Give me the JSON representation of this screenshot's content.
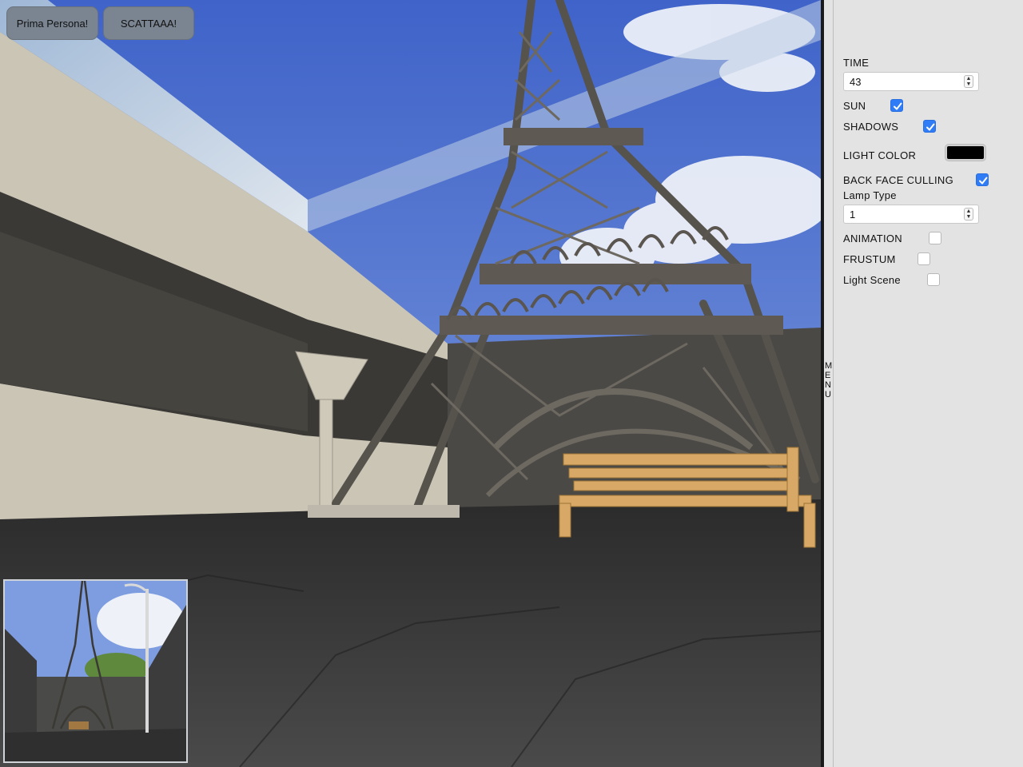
{
  "toolbar": {
    "first_person_label": "Prima Persona!",
    "shoot_label": "SCATTAAA!"
  },
  "menu_strip": {
    "label": "MENU"
  },
  "controls": {
    "time": {
      "label": "TIME",
      "value": "43"
    },
    "sun": {
      "label": "SUN",
      "checked": true
    },
    "shadows": {
      "label": "SHADOWS",
      "checked": true
    },
    "light_color": {
      "label": "LIGHT COLOR",
      "value": "#000000"
    },
    "back_face_culling": {
      "label": "BACK FACE CULLING",
      "checked": true
    },
    "lamp_type": {
      "label": "Lamp Type",
      "value": "1"
    },
    "animation": {
      "label": "ANIMATION",
      "checked": false
    },
    "frustum": {
      "label": "FRUSTUM",
      "checked": false
    },
    "light_scene": {
      "label": "Light Scene",
      "checked": false
    }
  },
  "colors": {
    "sky": "#5d7fd0",
    "wall": "#c9c3b3",
    "ground": "#3a3a3a",
    "tower": "#5a5650",
    "bench": "#d8a866",
    "checkbox_on": "#2f7cf6",
    "panel_bg": "#e3e3e3",
    "button_bg": "#7a8591"
  },
  "icons": {
    "checkmark": "checkmark-icon",
    "spinner": "spinner-arrows-icon"
  }
}
